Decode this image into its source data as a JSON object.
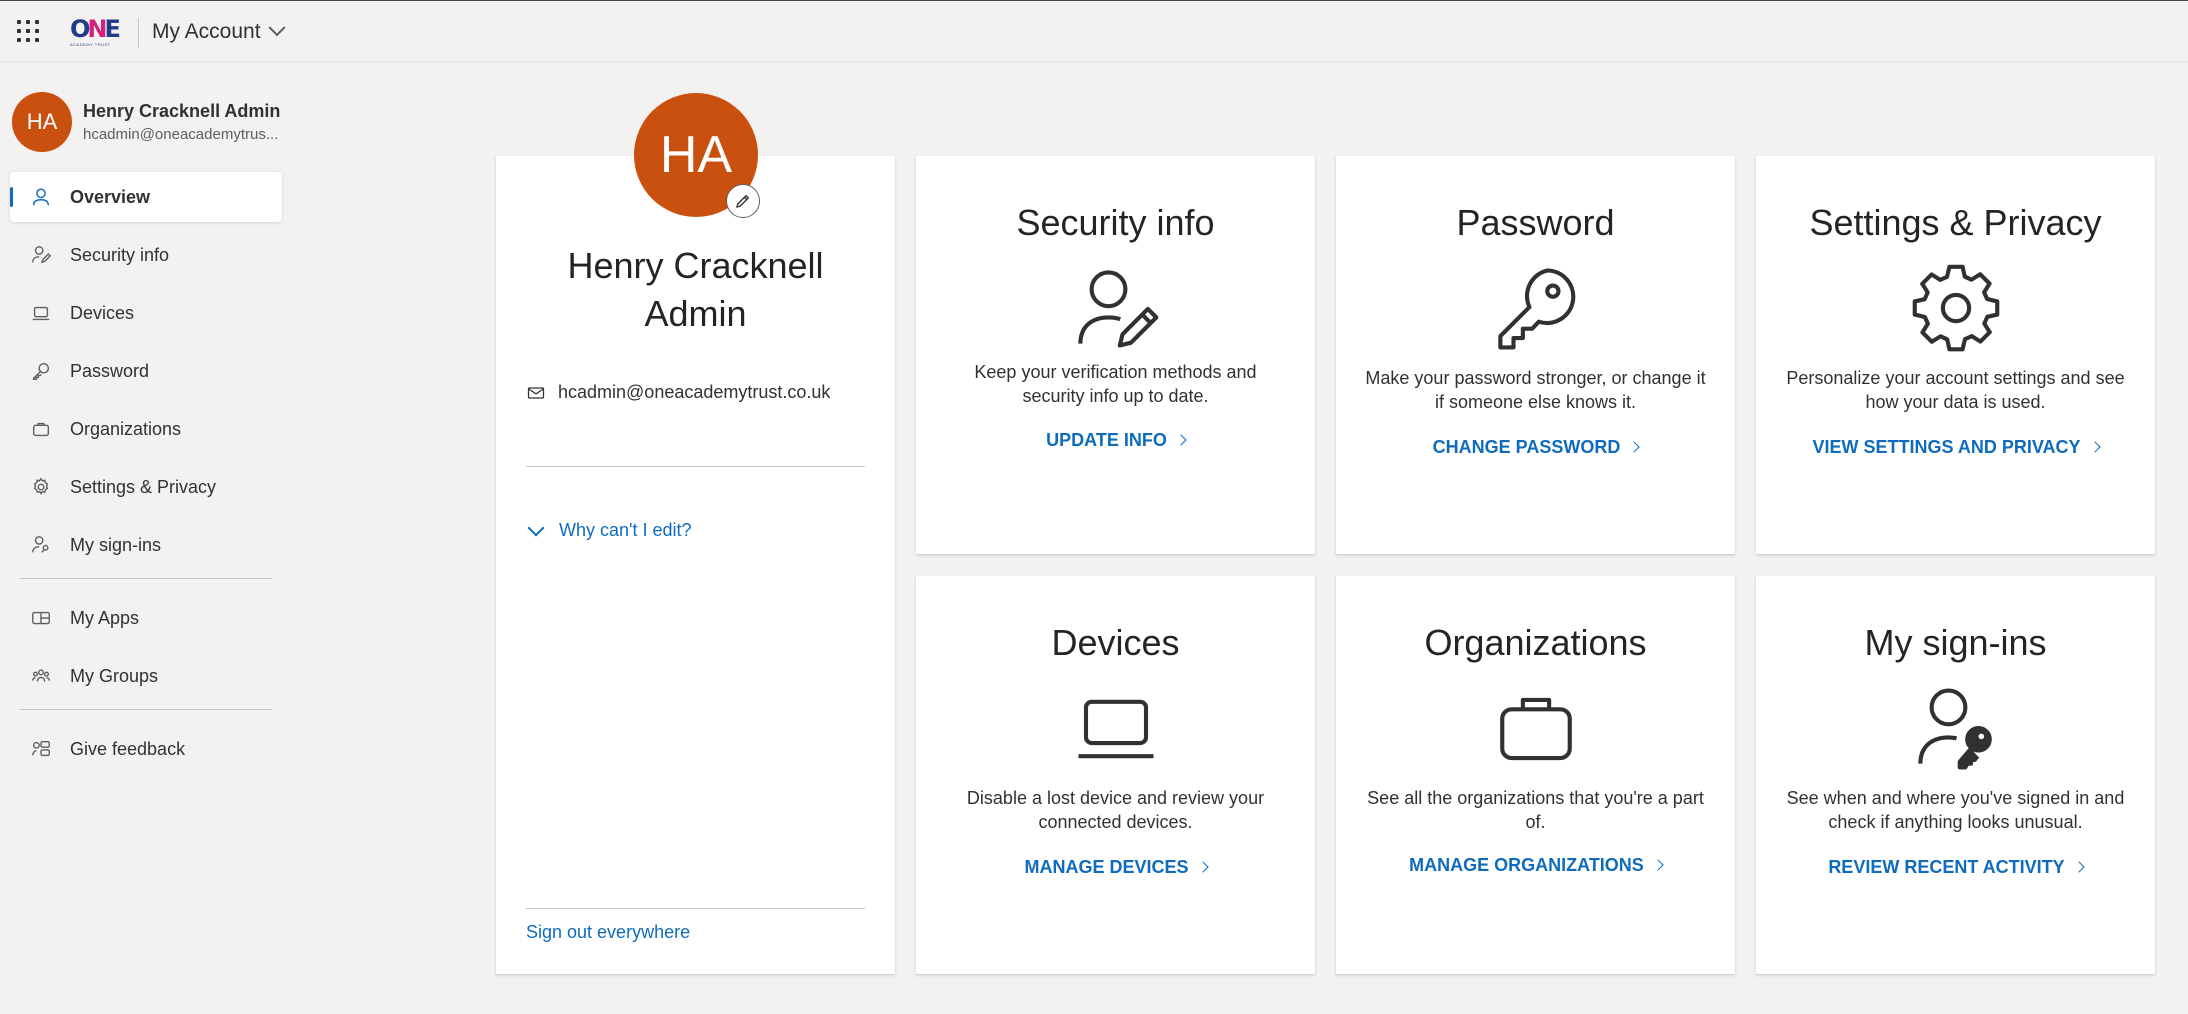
{
  "header": {
    "logo_text": "ONE",
    "logo_sub": "ACADEMY TRUST",
    "app_title": "My Account"
  },
  "user": {
    "initials": "HA",
    "name": "Henry Cracknell Admin",
    "name_line1": "Henry Cracknell",
    "name_line2": "Admin",
    "email": "hcadmin@oneacademytrust.co.uk",
    "email_truncated": "hcadmin@oneacademytrus..."
  },
  "sidebar": {
    "items": [
      {
        "label": "Overview",
        "icon": "person-icon"
      },
      {
        "label": "Security info",
        "icon": "person-edit-icon"
      },
      {
        "label": "Devices",
        "icon": "laptop-icon"
      },
      {
        "label": "Password",
        "icon": "key-icon"
      },
      {
        "label": "Organizations",
        "icon": "briefcase-icon"
      },
      {
        "label": "Settings & Privacy",
        "icon": "gear-icon"
      },
      {
        "label": "My sign-ins",
        "icon": "person-key-icon"
      },
      {
        "label": "My Apps",
        "icon": "apps-icon"
      },
      {
        "label": "My Groups",
        "icon": "people-icon"
      },
      {
        "label": "Give feedback",
        "icon": "feedback-icon"
      }
    ]
  },
  "profile_card": {
    "why_cant_edit": "Why can't I edit?",
    "sign_out": "Sign out everywhere"
  },
  "cards": [
    {
      "title": "Security info",
      "desc": "Keep your verification methods and security info up to date.",
      "link": "UPDATE INFO"
    },
    {
      "title": "Password",
      "desc": "Make your password stronger, or change it if someone else knows it.",
      "link": "CHANGE PASSWORD"
    },
    {
      "title": "Settings & Privacy",
      "desc": "Personalize your account settings and see how your data is used.",
      "link": "VIEW SETTINGS AND PRIVACY"
    },
    {
      "title": "Devices",
      "desc": "Disable a lost device and review your connected devices.",
      "link": "MANAGE DEVICES"
    },
    {
      "title": "Organizations",
      "desc": "See all the organizations that you're a part of.",
      "link": "MANAGE ORGANIZATIONS"
    },
    {
      "title": "My sign-ins",
      "desc": "See when and where you've signed in and check if anything looks unusual.",
      "link": "REVIEW RECENT ACTIVITY"
    }
  ],
  "colors": {
    "accent": "#0f6cbd",
    "avatar": "#ca5010",
    "background": "#f3f2f1"
  }
}
